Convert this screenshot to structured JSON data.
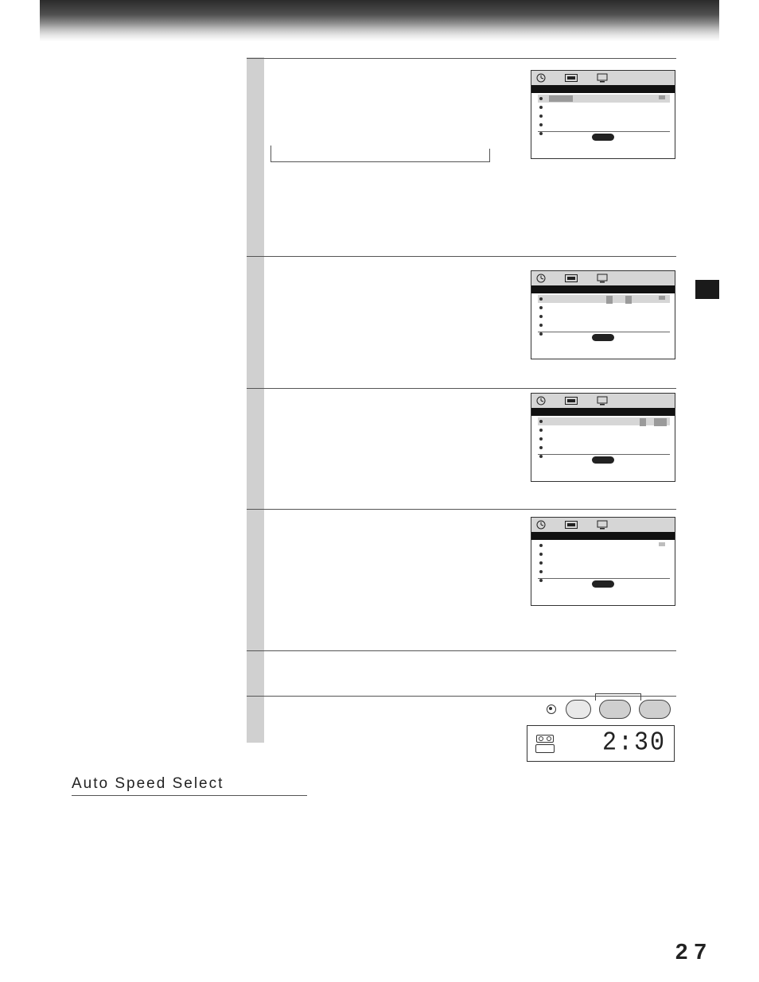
{
  "page_number": "27",
  "heading": "Auto Speed Select",
  "display": {
    "time": "2:30"
  },
  "icons": {
    "clock": "clock-icon",
    "tape": "tape-icon",
    "tv": "tv-icon"
  }
}
